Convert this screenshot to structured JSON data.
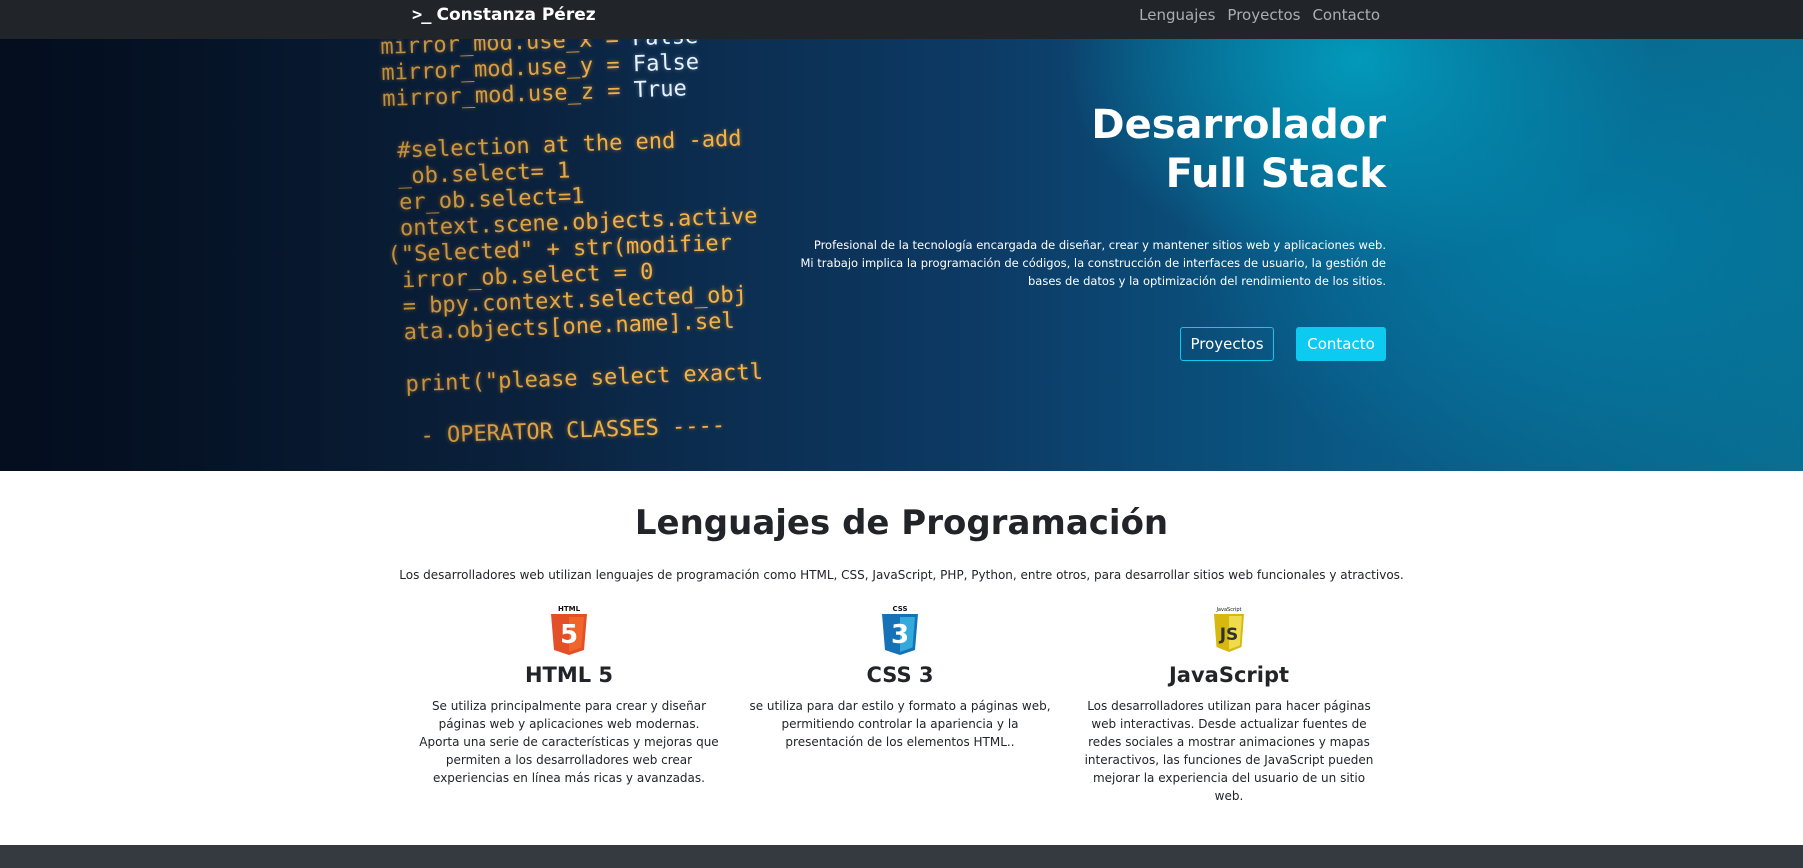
{
  "navbar": {
    "brand_prompt": ">_",
    "brand_name": "Constanza Pérez",
    "links": [
      "Lenguajes",
      "Proyectos",
      "Contacto"
    ]
  },
  "hero": {
    "title_line1": "Desarrolador",
    "title_line2": "Full Stack",
    "description_line1": "Profesional de la tecnología encargada de diseñar, crear y mantener sitios web y aplicaciones web.",
    "description_line2": "Mi trabajo implica la programación de códigos, la construcción de interfaces de usuario, la gestión de",
    "description_line3": "bases de datos y la optimización del rendimiento de los sitios.",
    "button_primary": "Proyectos",
    "button_secondary": "Contacto"
  },
  "languages": {
    "title": "Lenguajes de Programación",
    "description": "Los desarrolladores web utilizan lenguajes de programación como HTML, CSS, JavaScript, PHP, Python, entre otros, para desarrollar sitios web funcionales y atractivos.",
    "items": [
      {
        "icon": "html5-icon",
        "icon_label": "HTML",
        "icon_glyph": "5",
        "name": "HTML 5",
        "text": "Se utiliza principalmente para crear y diseñar páginas web y aplicaciones web modernas. Aporta una serie de características y mejoras que permiten a los desarrolladores web crear experiencias en línea más ricas y avanzadas.",
        "color": "#e34f26"
      },
      {
        "icon": "css3-icon",
        "icon_label": "CSS",
        "icon_glyph": "3",
        "name": "CSS 3",
        "text": "se utiliza para dar estilo y formato a páginas web, permitiendo controlar la apariencia y la presentación de los elementos HTML..",
        "color": "#1572b6"
      },
      {
        "icon": "javascript-icon",
        "icon_label": "JavaScript",
        "icon_glyph": "JS",
        "name": "JavaScript",
        "text": "Los desarrolladores utilizan para hacer páginas web interactivas. Desde actualizar fuentes de redes sociales a mostrar animaciones y mapas interactivos, las funciones de JavaScript pueden mejorar la experiencia del usuario de un sitio web.",
        "color": "#f0db4f"
      }
    ]
  },
  "colors": {
    "navbar_bg": "#212529",
    "accent": "#0dcaf0",
    "footer_bg": "#343a40"
  }
}
